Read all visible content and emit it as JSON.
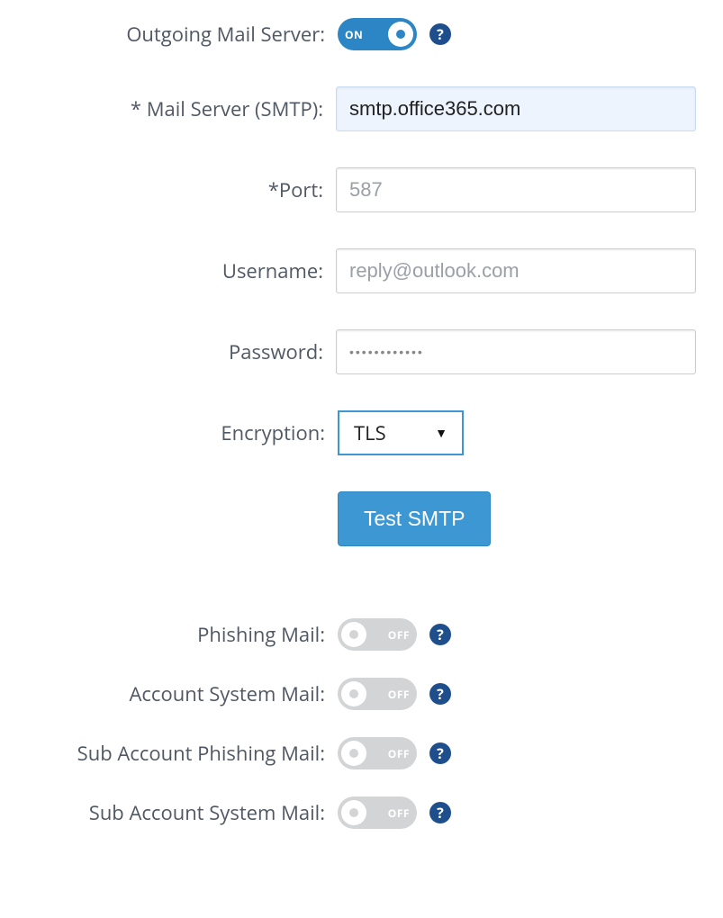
{
  "labels": {
    "outgoing": "Outgoing Mail Server:",
    "mail_server": "* Mail Server (SMTP):",
    "port": "*Port:",
    "username": "Username:",
    "password": "Password:",
    "encryption": "Encryption:",
    "phishing_mail": "Phishing Mail:",
    "account_system_mail": "Account System Mail:",
    "sub_phishing_mail": "Sub Account Phishing Mail:",
    "sub_system_mail": "Sub Account System Mail:"
  },
  "toggle": {
    "on": "ON",
    "off": "OFF",
    "outgoing_state": "on",
    "phishing_state": "off",
    "account_system_state": "off",
    "sub_phishing_state": "off",
    "sub_system_state": "off"
  },
  "fields": {
    "mail_server_value": "smtp.office365.com",
    "port_placeholder": "587",
    "username_placeholder": "reply@outlook.com",
    "password_value": "••••••••••••",
    "encryption_value": "TLS"
  },
  "buttons": {
    "test_smtp": "Test SMTP"
  },
  "icons": {
    "help_glyph": "?"
  }
}
